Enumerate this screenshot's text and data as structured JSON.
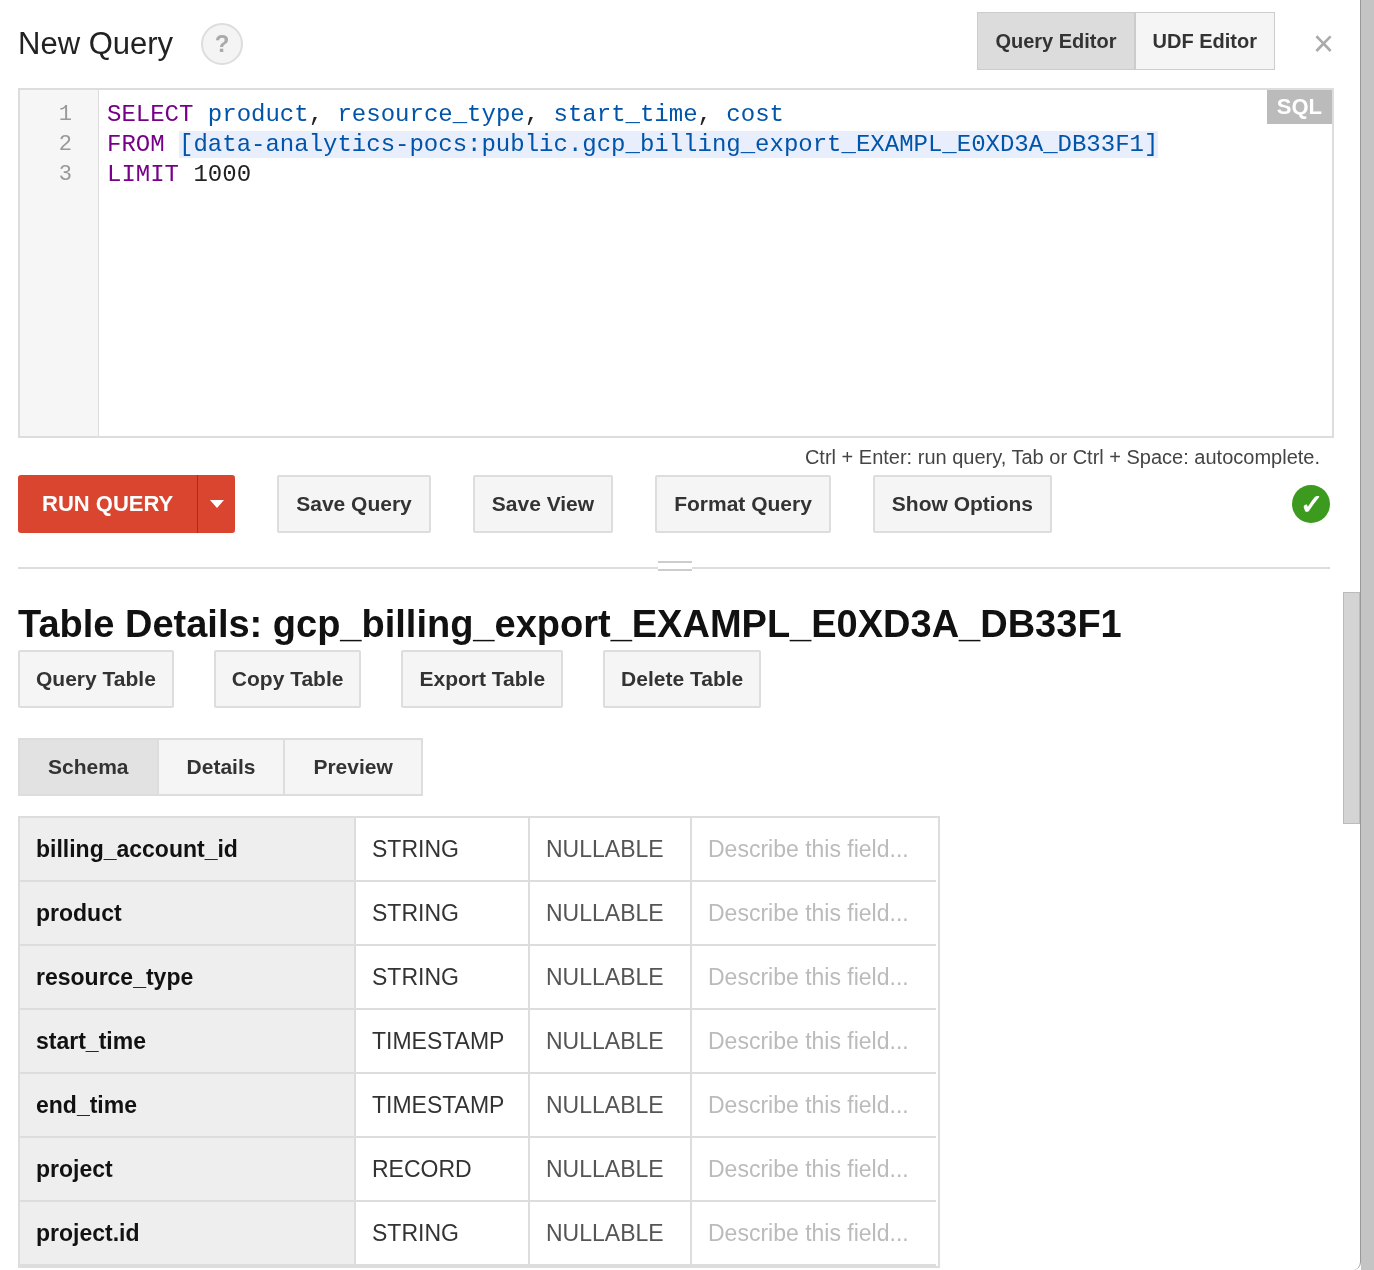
{
  "dialog": {
    "title": "New Query",
    "help": "?",
    "editor_tabs": [
      {
        "label": "Query Editor",
        "selected": true
      },
      {
        "label": "UDF Editor",
        "selected": false
      }
    ],
    "close": "×"
  },
  "editor": {
    "mode_badge": "SQL",
    "lines": [
      {
        "number": "1",
        "tokens": [
          {
            "kind": "keyword",
            "text": "SELECT",
            "highlighted": false
          },
          {
            "kind": "identifier",
            "text": "product",
            "highlighted": false
          },
          {
            "kind": "punct",
            "text": ",",
            "highlighted": false
          },
          {
            "kind": "identifier",
            "text": "resource_type",
            "highlighted": false
          },
          {
            "kind": "punct",
            "text": ",",
            "highlighted": false
          },
          {
            "kind": "identifier",
            "text": "start_time",
            "highlighted": false
          },
          {
            "kind": "punct",
            "text": ",",
            "highlighted": false
          },
          {
            "kind": "identifier",
            "text": "cost",
            "highlighted": false
          }
        ]
      },
      {
        "number": "2",
        "tokens": [
          {
            "kind": "keyword",
            "text": "FROM",
            "highlighted": false
          },
          {
            "kind": "identifier",
            "text": "[data-analytics-pocs:public.gcp_billing_export_EXAMPL_E0XD3A_DB33F1]",
            "highlighted": true
          }
        ]
      },
      {
        "number": "3",
        "tokens": [
          {
            "kind": "keyword",
            "text": "LIMIT",
            "highlighted": false
          },
          {
            "kind": "number",
            "text": "1000",
            "highlighted": false
          }
        ]
      }
    ]
  },
  "hint": "Ctrl + Enter: run query, Tab or Ctrl + Space: autocomplete.",
  "run_button": "RUN QUERY",
  "actions": [
    "Save Query",
    "Save View",
    "Format Query",
    "Show Options"
  ],
  "validation": {
    "valid": true,
    "symbol": "✓"
  },
  "table_details": {
    "title": "Table Details: gcp_billing_export_EXAMPL_E0XD3A_DB33F1",
    "buttons": [
      "Query Table",
      "Copy Table",
      "Export Table",
      "Delete Table"
    ],
    "tabs": [
      {
        "label": "Schema",
        "selected": true
      },
      {
        "label": "Details",
        "selected": false
      },
      {
        "label": "Preview",
        "selected": false
      }
    ],
    "schema": [
      {
        "name": "billing_account_id",
        "type": "STRING",
        "mode": "NULLABLE",
        "placeholder": "Describe this field..."
      },
      {
        "name": "product",
        "type": "STRING",
        "mode": "NULLABLE",
        "placeholder": "Describe this field..."
      },
      {
        "name": "resource_type",
        "type": "STRING",
        "mode": "NULLABLE",
        "placeholder": "Describe this field..."
      },
      {
        "name": "start_time",
        "type": "TIMESTAMP",
        "mode": "NULLABLE",
        "placeholder": "Describe this field..."
      },
      {
        "name": "end_time",
        "type": "TIMESTAMP",
        "mode": "NULLABLE",
        "placeholder": "Describe this field..."
      },
      {
        "name": "project",
        "type": "RECORD",
        "mode": "NULLABLE",
        "placeholder": "Describe this field..."
      },
      {
        "name": "project.id",
        "type": "STRING",
        "mode": "NULLABLE",
        "placeholder": "Describe this field..."
      }
    ]
  }
}
